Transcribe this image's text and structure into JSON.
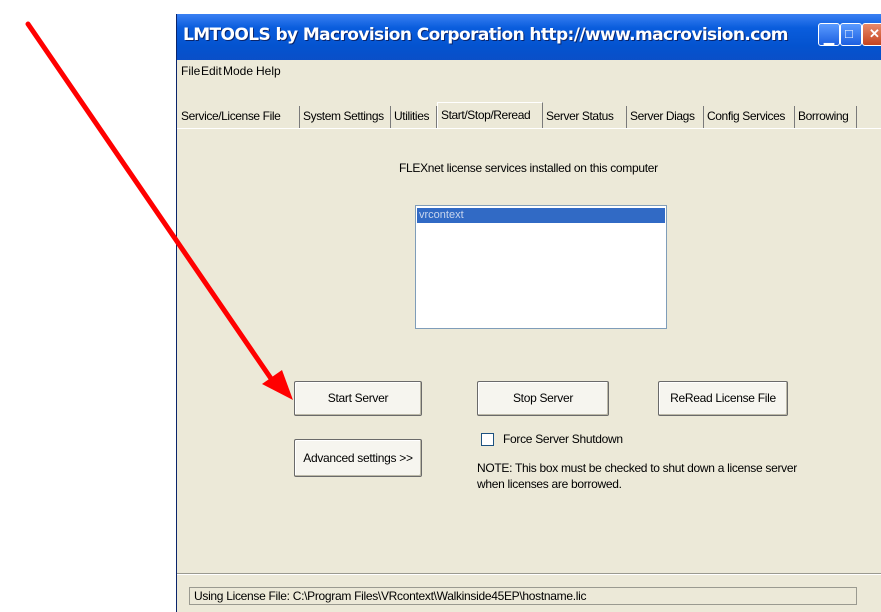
{
  "window": {
    "title": "LMTOOLS by Macrovision Corporation http://www.macrovision.com"
  },
  "menu": [
    "File",
    "Edit",
    "Mode",
    "Help"
  ],
  "tabs": [
    "Service/License File",
    "System Settings",
    "Utilities",
    "Start/Stop/Reread",
    "Server Status",
    "Server Diags",
    "Config Services",
    "Borrowing"
  ],
  "active_tab": "Start/Stop/Reread",
  "main": {
    "installed_label": "FLEXnet license services installed on this computer",
    "services": [
      "vrcontext"
    ],
    "start_button": "Start Server",
    "stop_button": "Stop Server",
    "reread_button": "ReRead License File",
    "advanced_button": "Advanced settings >>",
    "force_shutdown_label": "Force Server Shutdown",
    "force_shutdown_checked": false,
    "note_line1": "NOTE:  This box must be checked to shut down a license server",
    "note_line2": "when licenses are borrowed."
  },
  "status": {
    "text": "Using License File:  C:\\Program Files\\VRcontext\\Walkinside45EP\\hostname.lic"
  },
  "colors": {
    "annotation_arrow": "#ff0000",
    "titlebar": "#0a5ddd",
    "selection": "#316ac5"
  }
}
